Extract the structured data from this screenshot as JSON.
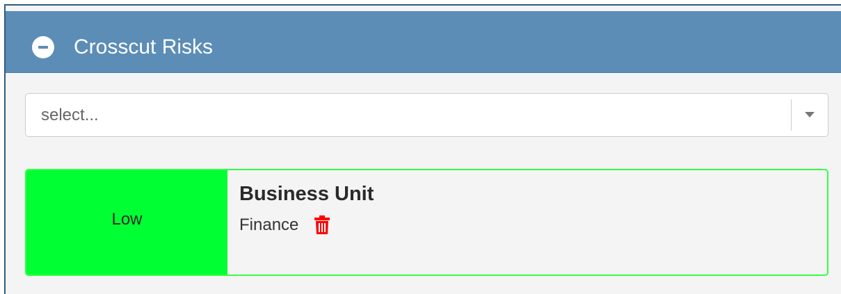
{
  "panel": {
    "title": "Crosscut Risks",
    "header_color": "#5b8db6",
    "collapse_icon": "minus-circle-icon"
  },
  "select": {
    "placeholder": "select..."
  },
  "risk_card": {
    "level": "Low",
    "level_color": "#00ff33",
    "heading": "Business Unit",
    "items": [
      {
        "label": "Finance",
        "action_icon": "trash-icon",
        "action_color": "#ff0000"
      }
    ]
  }
}
